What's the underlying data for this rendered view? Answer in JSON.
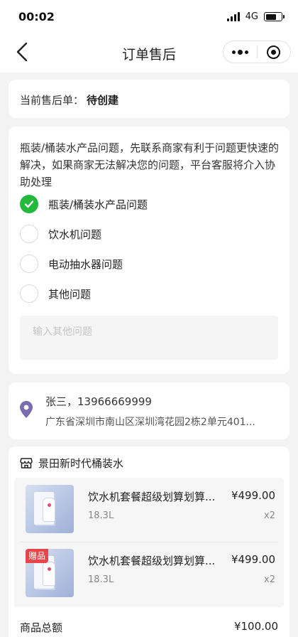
{
  "status_bar": {
    "time": "00:02",
    "network": "4G"
  },
  "nav": {
    "title": "订单售后"
  },
  "status_card": {
    "label": "当前售后单：",
    "value": "待创建"
  },
  "problem": {
    "description": "瓶装/桶装水产品问题，先联系商家有利于问题更快速的解决，如果商家无法解决您的问题，平台客服将介入协助处理",
    "options": [
      {
        "label": "瓶装/桶装水产品问题",
        "checked": true
      },
      {
        "label": "饮水机问题",
        "checked": false
      },
      {
        "label": "电动抽水器问题",
        "checked": false
      },
      {
        "label": "其他问题",
        "checked": false
      }
    ],
    "other_placeholder": "输入其他问题",
    "other_value": ""
  },
  "address": {
    "name_phone": "张三，13966669999",
    "detail": "广东省深圳市南山区深圳湾花园2栋2单元401..."
  },
  "store": {
    "name": "景田新时代桶装水",
    "items": [
      {
        "name": "饮水机套餐超级划算划算...",
        "price": "¥499.00",
        "spec": "18.3L",
        "qty": "x2",
        "tag": ""
      },
      {
        "name": "饮水机套餐超级划算划算...",
        "price": "¥499.00",
        "spec": "18.3L",
        "qty": "x2",
        "tag": "赠品"
      }
    ]
  },
  "summary": {
    "total_label": "商品总额",
    "total_value": "¥100.00"
  },
  "colors": {
    "accent_green": "#23b93c",
    "location_purple": "#7a6cae",
    "gift_red": "#e8454a"
  }
}
